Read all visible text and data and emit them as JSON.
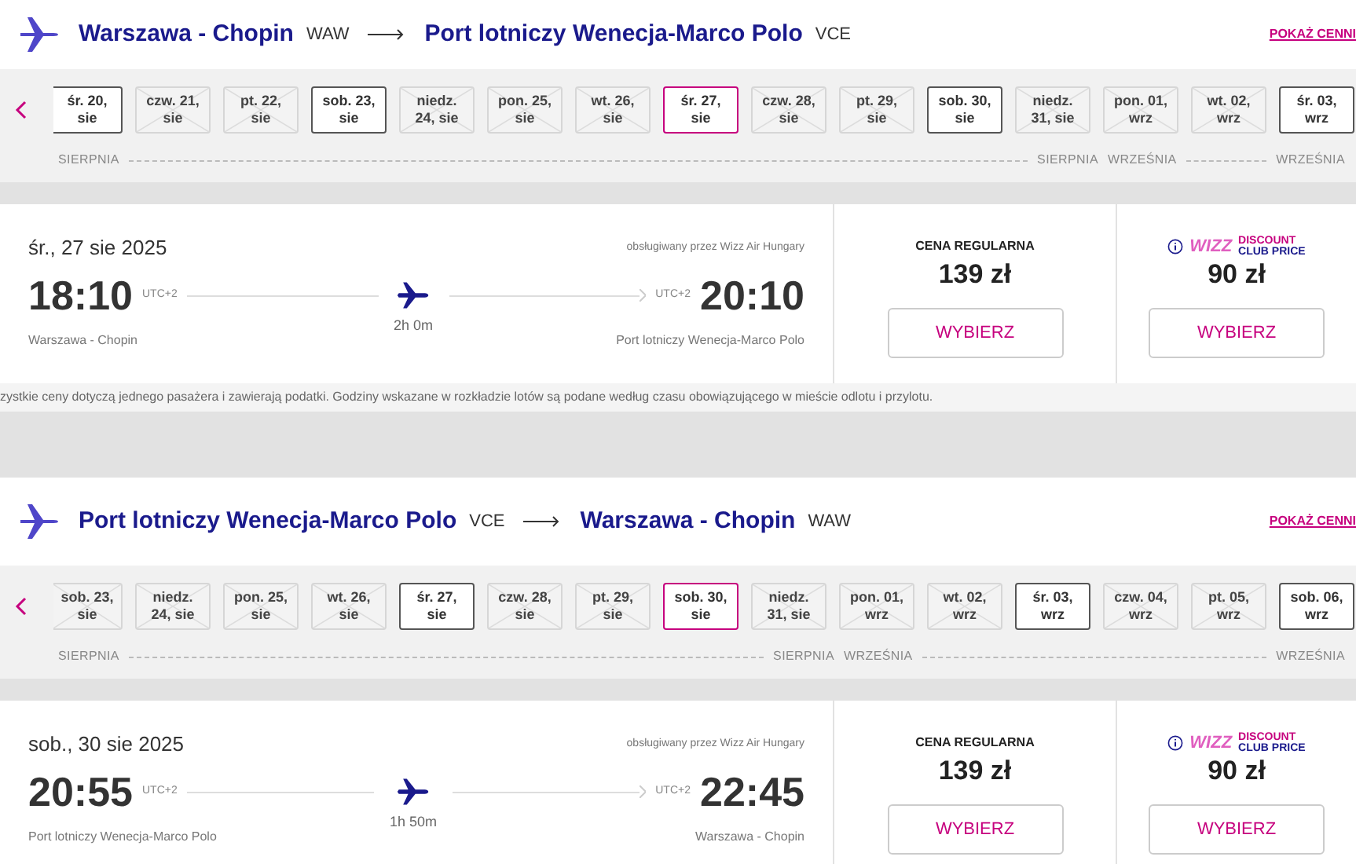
{
  "journeys": [
    {
      "origin": "Warszawa - Chopin",
      "origin_code": "WAW",
      "destination": "Port lotniczy Wenecja-Marco Polo",
      "destination_code": "VCE",
      "price_list_link": "POKAŻ CENNI",
      "months": [
        {
          "start_label": "SIERPNIA",
          "end_label": "SIERPNIA",
          "dates": [
            {
              "day": "śr. 20,",
              "month": "sie",
              "available": true,
              "selected": false
            },
            {
              "day": "czw. 21,",
              "month": "sie",
              "available": false,
              "selected": false
            },
            {
              "day": "pt. 22,",
              "month": "sie",
              "available": false,
              "selected": false
            },
            {
              "day": "sob. 23,",
              "month": "sie",
              "available": true,
              "selected": false
            },
            {
              "day": "niedz.",
              "month": "24, sie",
              "available": false,
              "selected": false
            },
            {
              "day": "pon. 25,",
              "month": "sie",
              "available": false,
              "selected": false
            },
            {
              "day": "wt. 26,",
              "month": "sie",
              "available": false,
              "selected": false
            },
            {
              "day": "śr. 27,",
              "month": "sie",
              "available": true,
              "selected": true
            },
            {
              "day": "czw. 28,",
              "month": "sie",
              "available": false,
              "selected": false
            },
            {
              "day": "pt. 29,",
              "month": "sie",
              "available": false,
              "selected": false
            },
            {
              "day": "sob. 30,",
              "month": "sie",
              "available": true,
              "selected": false
            },
            {
              "day": "niedz.",
              "month": "31, sie",
              "available": false,
              "selected": false
            }
          ]
        },
        {
          "start_label": "WRZEŚNIA",
          "end_label": "WRZEŚNIA",
          "dates": [
            {
              "day": "pon. 01,",
              "month": "wrz",
              "available": false,
              "selected": false
            },
            {
              "day": "wt. 02,",
              "month": "wrz",
              "available": false,
              "selected": false
            },
            {
              "day": "śr. 03,",
              "month": "wrz",
              "available": true,
              "selected": false
            }
          ]
        }
      ],
      "flight": {
        "date": "śr., 27 sie 2025",
        "operator": "obsługiwany przez Wizz Air Hungary",
        "departure_time": "18:10",
        "departure_tz": "UTC+2",
        "arrival_time": "20:10",
        "arrival_tz": "UTC+2",
        "duration": "2h 0m",
        "departure_airport": "Warszawa - Chopin",
        "arrival_airport": "Port lotniczy Wenecja-Marco Polo"
      },
      "fares": [
        {
          "kind": "regular",
          "label": "CENA REGULARNA",
          "price": "139 zł",
          "button": "WYBIERZ"
        },
        {
          "kind": "club",
          "logo": "WIZZ",
          "badge_top": "DISCOUNT",
          "badge_bottom": "CLUB PRICE",
          "price": "90 zł",
          "button": "WYBIERZ"
        }
      ],
      "note": "zystkie ceny dotyczą jednego pasażera i zawierają podatki. Godziny wskazane w rozkładzie lotów są podane według czasu obowiązującego w mieście odlotu i przylotu."
    },
    {
      "origin": "Port lotniczy Wenecja-Marco Polo",
      "origin_code": "VCE",
      "destination": "Warszawa - Chopin",
      "destination_code": "WAW",
      "price_list_link": "POKAŻ CENNI",
      "months": [
        {
          "start_label": "SIERPNIA",
          "end_label": "SIERPNIA",
          "dates": [
            {
              "day": "sob. 23,",
              "month": "sie",
              "available": false,
              "selected": false
            },
            {
              "day": "niedz.",
              "month": "24, sie",
              "available": false,
              "selected": false
            },
            {
              "day": "pon. 25,",
              "month": "sie",
              "available": false,
              "selected": false
            },
            {
              "day": "wt. 26,",
              "month": "sie",
              "available": false,
              "selected": false
            },
            {
              "day": "śr. 27,",
              "month": "sie",
              "available": true,
              "selected": false
            },
            {
              "day": "czw. 28,",
              "month": "sie",
              "available": false,
              "selected": false
            },
            {
              "day": "pt. 29,",
              "month": "sie",
              "available": false,
              "selected": false
            },
            {
              "day": "sob. 30,",
              "month": "sie",
              "available": true,
              "selected": true
            },
            {
              "day": "niedz.",
              "month": "31, sie",
              "available": false,
              "selected": false
            }
          ]
        },
        {
          "start_label": "WRZEŚNIA",
          "end_label": "WRZEŚNIA",
          "dates": [
            {
              "day": "pon. 01,",
              "month": "wrz",
              "available": false,
              "selected": false
            },
            {
              "day": "wt. 02,",
              "month": "wrz",
              "available": false,
              "selected": false
            },
            {
              "day": "śr. 03,",
              "month": "wrz",
              "available": true,
              "selected": false
            },
            {
              "day": "czw. 04,",
              "month": "wrz",
              "available": false,
              "selected": false
            },
            {
              "day": "pt. 05,",
              "month": "wrz",
              "available": false,
              "selected": false
            },
            {
              "day": "sob. 06,",
              "month": "wrz",
              "available": true,
              "selected": false
            }
          ]
        }
      ],
      "flight": {
        "date": "sob., 30 sie 2025",
        "operator": "obsługiwany przez Wizz Air Hungary",
        "departure_time": "20:55",
        "departure_tz": "UTC+2",
        "arrival_time": "22:45",
        "arrival_tz": "UTC+2",
        "duration": "1h 50m",
        "departure_airport": "Port lotniczy Wenecja-Marco Polo",
        "arrival_airport": "Warszawa - Chopin"
      },
      "fares": [
        {
          "kind": "regular",
          "label": "CENA REGULARNA",
          "price": "139 zł",
          "button": "WYBIERZ"
        },
        {
          "kind": "club",
          "logo": "WIZZ",
          "badge_top": "DISCOUNT",
          "badge_bottom": "CLUB PRICE",
          "price": "90 zł",
          "button": "WYBIERZ"
        }
      ]
    }
  ]
}
